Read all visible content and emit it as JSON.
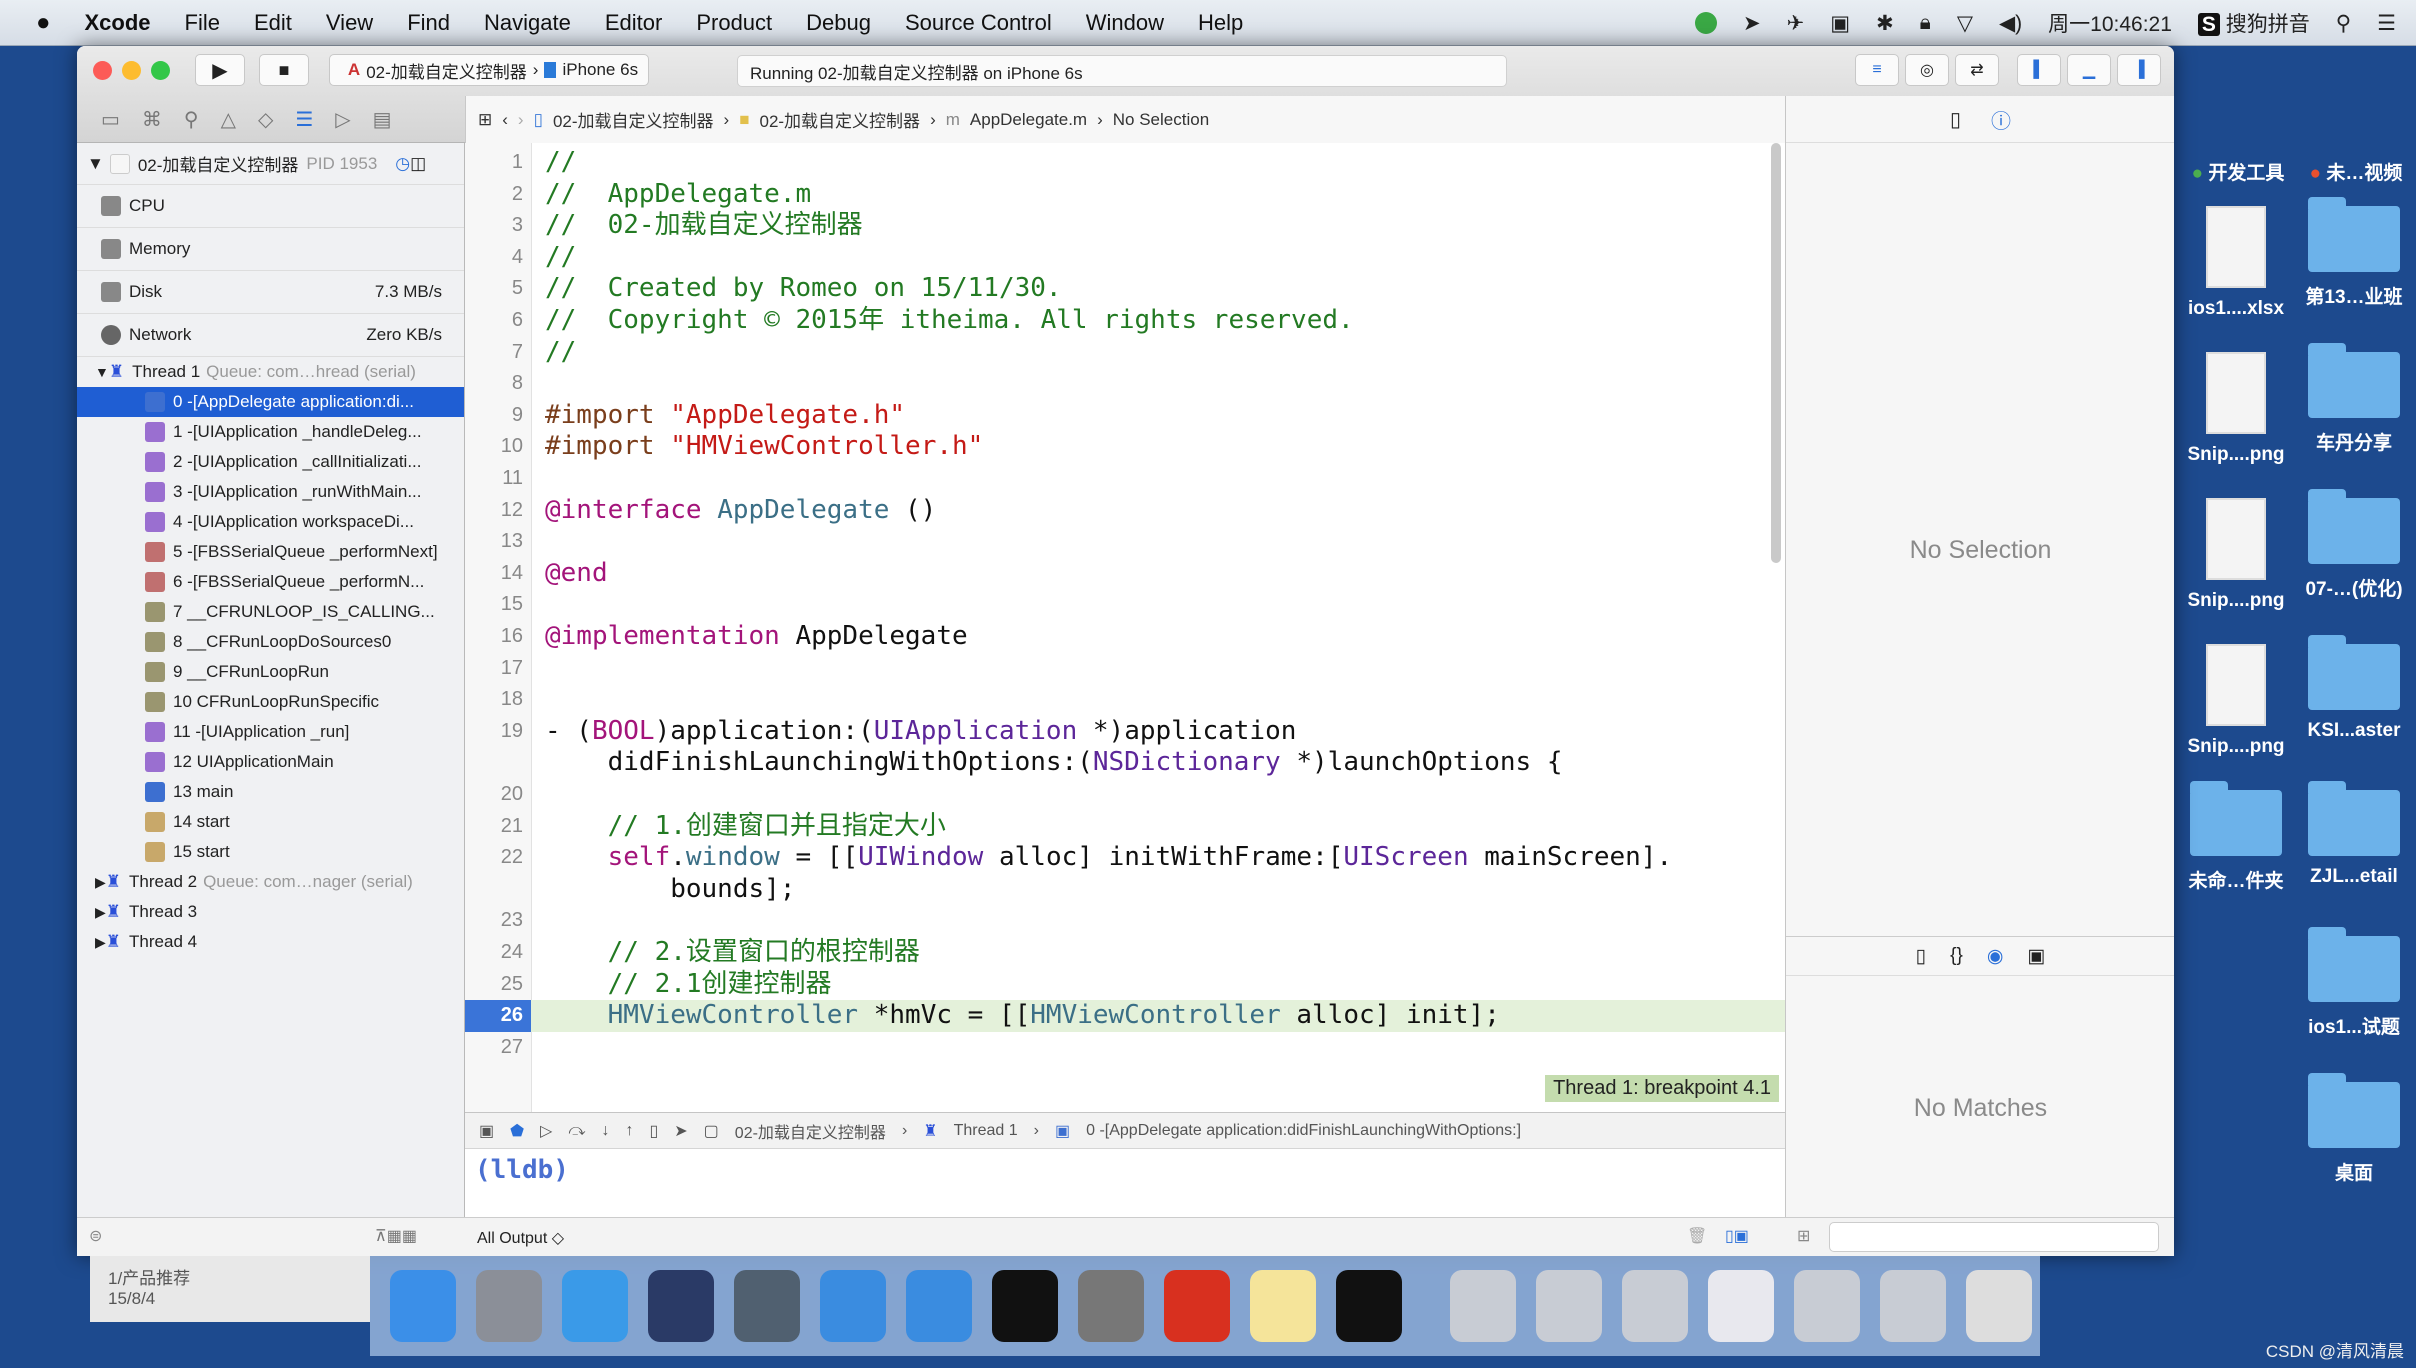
{
  "menubar": {
    "apple": "",
    "items": [
      "Xcode",
      "File",
      "Edit",
      "View",
      "Find",
      "Navigate",
      "Editor",
      "Product",
      "Debug",
      "Source Control",
      "Window",
      "Help"
    ],
    "clock": "周一10:46:21",
    "input_method": "搜狗拼音"
  },
  "toolbar": {
    "scheme": "02-加载自定义控制器",
    "device": "iPhone 6s",
    "activity": "Running 02-加载自定义控制器 on iPhone 6s"
  },
  "jumpbar": [
    "02-加载自定义控制器",
    "02-加载自定义控制器",
    "AppDelegate.m",
    "No Selection"
  ],
  "navigator": {
    "process": {
      "name": "02-加载自定义控制器",
      "pid": "PID 1953"
    },
    "gauges": [
      {
        "label": "CPU",
        "value": ""
      },
      {
        "label": "Memory",
        "value": ""
      },
      {
        "label": "Disk",
        "value": "7.3 MB/s"
      },
      {
        "label": "Network",
        "value": "Zero KB/s"
      }
    ],
    "thread1": {
      "label": "Thread 1",
      "queue": "Queue: com…hread (serial)"
    },
    "frames": [
      {
        "label": "0 -[AppDelegate application:di...",
        "color": "#3d6fd0",
        "selected": true
      },
      {
        "label": "1 -[UIApplication _handleDeleg...",
        "color": "#9a6fd0"
      },
      {
        "label": "2 -[UIApplication _callInitializati...",
        "color": "#9a6fd0"
      },
      {
        "label": "3 -[UIApplication _runWithMain...",
        "color": "#9a6fd0"
      },
      {
        "label": "4 -[UIApplication workspaceDi...",
        "color": "#9a6fd0"
      },
      {
        "label": "5 -[FBSSerialQueue _performNext]",
        "color": "#c07070"
      },
      {
        "label": "6 -[FBSSerialQueue _performN...",
        "color": "#c07070"
      },
      {
        "label": "7 __CFRUNLOOP_IS_CALLING...",
        "color": "#9a9670"
      },
      {
        "label": "8 __CFRunLoopDoSources0",
        "color": "#9a9670"
      },
      {
        "label": "9 __CFRunLoopRun",
        "color": "#9a9670"
      },
      {
        "label": "10 CFRunLoopRunSpecific",
        "color": "#9a9670"
      },
      {
        "label": "11 -[UIApplication _run]",
        "color": "#9a6fd0"
      },
      {
        "label": "12 UIApplicationMain",
        "color": "#9a6fd0"
      },
      {
        "label": "13 main",
        "color": "#3d6fd0"
      },
      {
        "label": "14 start",
        "color": "#c8a86a"
      },
      {
        "label": "15 start",
        "color": "#c8a86a"
      }
    ],
    "threads": [
      {
        "label": "Thread 2",
        "queue": "Queue: com…nager (serial)"
      },
      {
        "label": "Thread 3",
        "queue": ""
      },
      {
        "label": "Thread 4",
        "queue": ""
      }
    ]
  },
  "editor": {
    "current_line": "26",
    "breakpoint_label": "Thread 1: breakpoint 4.1",
    "lines": [
      {
        "n": "1",
        "tokens": [
          [
            "cm",
            "//"
          ]
        ]
      },
      {
        "n": "2",
        "tokens": [
          [
            "cm",
            "//  AppDelegate.m"
          ]
        ]
      },
      {
        "n": "3",
        "tokens": [
          [
            "cm",
            "//  02-加载自定义控制器"
          ]
        ]
      },
      {
        "n": "4",
        "tokens": [
          [
            "cm",
            "//"
          ]
        ]
      },
      {
        "n": "5",
        "tokens": [
          [
            "cm",
            "//  Created by Romeo on 15/11/30."
          ]
        ]
      },
      {
        "n": "6",
        "tokens": [
          [
            "cm",
            "//  Copyright © 2015年 itheima. All rights reserved."
          ]
        ]
      },
      {
        "n": "7",
        "tokens": [
          [
            "cm",
            "//"
          ]
        ]
      },
      {
        "n": "8",
        "tokens": []
      },
      {
        "n": "9",
        "tokens": [
          [
            "pp",
            "#import "
          ],
          [
            "st",
            "\"AppDelegate.h\""
          ]
        ]
      },
      {
        "n": "10",
        "tokens": [
          [
            "pp",
            "#import "
          ],
          [
            "st",
            "\"HMViewController.h\""
          ]
        ]
      },
      {
        "n": "11",
        "tokens": []
      },
      {
        "n": "12",
        "tokens": [
          [
            "kw",
            "@interface "
          ],
          [
            "cl",
            "AppDelegate"
          ],
          [
            "tx",
            " ()"
          ]
        ]
      },
      {
        "n": "13",
        "tokens": []
      },
      {
        "n": "14",
        "tokens": [
          [
            "kw",
            "@end"
          ]
        ]
      },
      {
        "n": "15",
        "tokens": []
      },
      {
        "n": "16",
        "tokens": [
          [
            "kw",
            "@implementation "
          ],
          [
            "tx",
            "AppDelegate"
          ]
        ]
      },
      {
        "n": "17",
        "tokens": []
      },
      {
        "n": "18",
        "tokens": []
      },
      {
        "n": "19",
        "tokens": [
          [
            "tx",
            "- ("
          ],
          [
            "kw",
            "BOOL"
          ],
          [
            "tx",
            ")application:("
          ],
          [
            "ty",
            "UIApplication"
          ],
          [
            "tx",
            " *)application"
          ]
        ]
      },
      {
        "n": "",
        "tokens": [
          [
            "tx",
            "    didFinishLaunchingWithOptions:("
          ],
          [
            "ty",
            "NSDictionary"
          ],
          [
            "tx",
            " *)launchOptions {"
          ]
        ]
      },
      {
        "n": "20",
        "tokens": []
      },
      {
        "n": "21",
        "tokens": [
          [
            "cm",
            "    // 1.创建窗口并且指定大小"
          ]
        ]
      },
      {
        "n": "22",
        "tokens": [
          [
            "tx",
            "    "
          ],
          [
            "kw",
            "self"
          ],
          [
            "tx",
            "."
          ],
          [
            "pr",
            "window"
          ],
          [
            "tx",
            " = [["
          ],
          [
            "ty",
            "UIWindow"
          ],
          [
            "tx",
            " alloc] initWithFrame:["
          ],
          [
            "ty",
            "UIScreen"
          ],
          [
            "tx",
            " mainScreen]."
          ]
        ]
      },
      {
        "n": "",
        "tokens": [
          [
            "tx",
            "        bounds];"
          ]
        ]
      },
      {
        "n": "23",
        "tokens": []
      },
      {
        "n": "24",
        "tokens": [
          [
            "cm",
            "    // 2.设置窗口的根控制器"
          ]
        ]
      },
      {
        "n": "25",
        "tokens": [
          [
            "cm",
            "    // 2.1创建控制器"
          ]
        ]
      },
      {
        "n": "26",
        "tokens": [
          [
            "cl",
            "    HMViewController"
          ],
          [
            "tx",
            " *hmVc = [["
          ],
          [
            "cl",
            "HMViewController"
          ],
          [
            "tx",
            " alloc] init];"
          ]
        ]
      },
      {
        "n": "27",
        "tokens": []
      }
    ]
  },
  "debugbar": {
    "process": "02-加载自定义控制器",
    "thread": "Thread 1",
    "frame": "0 -[AppDelegate application:didFinishLaunchingWithOptions:]"
  },
  "console": {
    "prompt": "(lldb)",
    "output_filter": "All Output ◇"
  },
  "inspector": {
    "top_empty": "No Selection",
    "bottom_empty": "No Matches"
  },
  "desktop": {
    "tags": [
      {
        "label": "开发工具",
        "color": "#4caf50"
      },
      {
        "label": "未…视频",
        "color": "#e9502f"
      }
    ],
    "icons": [
      {
        "label": "ios1....xlsx",
        "kind": "doc"
      },
      {
        "label": "第13…业班",
        "kind": "folder"
      },
      {
        "label": "Snip....png",
        "kind": "doc"
      },
      {
        "label": "车丹分享",
        "kind": "folder"
      },
      {
        "label": "Snip....png",
        "kind": "doc"
      },
      {
        "label": "07-…(优化)",
        "kind": "folder"
      },
      {
        "label": "Snip....png",
        "kind": "doc"
      },
      {
        "label": "KSI...aster",
        "kind": "folder"
      },
      {
        "label": "未命…件夹",
        "kind": "folder"
      },
      {
        "label": "ZJL...etail",
        "kind": "folder"
      },
      {
        "label": "",
        "kind": "none"
      },
      {
        "label": "ios1...试题",
        "kind": "folder"
      },
      {
        "label": "",
        "kind": "none"
      },
      {
        "label": "桌面",
        "kind": "folder"
      }
    ]
  },
  "notification": {
    "title": "1/产品推荐",
    "date": "15/8/4"
  },
  "dock": [
    {
      "name": "finder",
      "color": "#3b8fe8"
    },
    {
      "name": "launchpad",
      "color": "#8b8f98"
    },
    {
      "name": "safari",
      "color": "#3a9ae8"
    },
    {
      "name": "mouse-app",
      "color": "#2a3a66"
    },
    {
      "name": "photo-booth",
      "color": "#506070"
    },
    {
      "name": "xcode",
      "color": "#3a8ce0"
    },
    {
      "name": "instruments",
      "color": "#3a8ce0"
    },
    {
      "name": "terminal",
      "color": "#111111"
    },
    {
      "name": "system-preferences",
      "color": "#777777"
    },
    {
      "name": "xmind",
      "color": "#d8301f"
    },
    {
      "name": "notes",
      "color": "#f5e49a"
    },
    {
      "name": "console",
      "color": "#111111"
    },
    {
      "name": "screen-1",
      "color": "#c8ccd4"
    },
    {
      "name": "screen-2",
      "color": "#c8ccd4"
    },
    {
      "name": "screen-3",
      "color": "#c8ccd4"
    },
    {
      "name": "screen-4",
      "color": "#e8e8ee"
    },
    {
      "name": "screen-5",
      "color": "#c8ccd4"
    },
    {
      "name": "screen-6",
      "color": "#c8ccd4"
    },
    {
      "name": "trash",
      "color": "#dddddd"
    }
  ],
  "watermark": "CSDN @清风清晨",
  "colors": {
    "selection": "#1f5ed3",
    "current_line": "#e4f1da",
    "breakpoint_label": "#c4dcae",
    "desktop": "#1d4a8e"
  }
}
